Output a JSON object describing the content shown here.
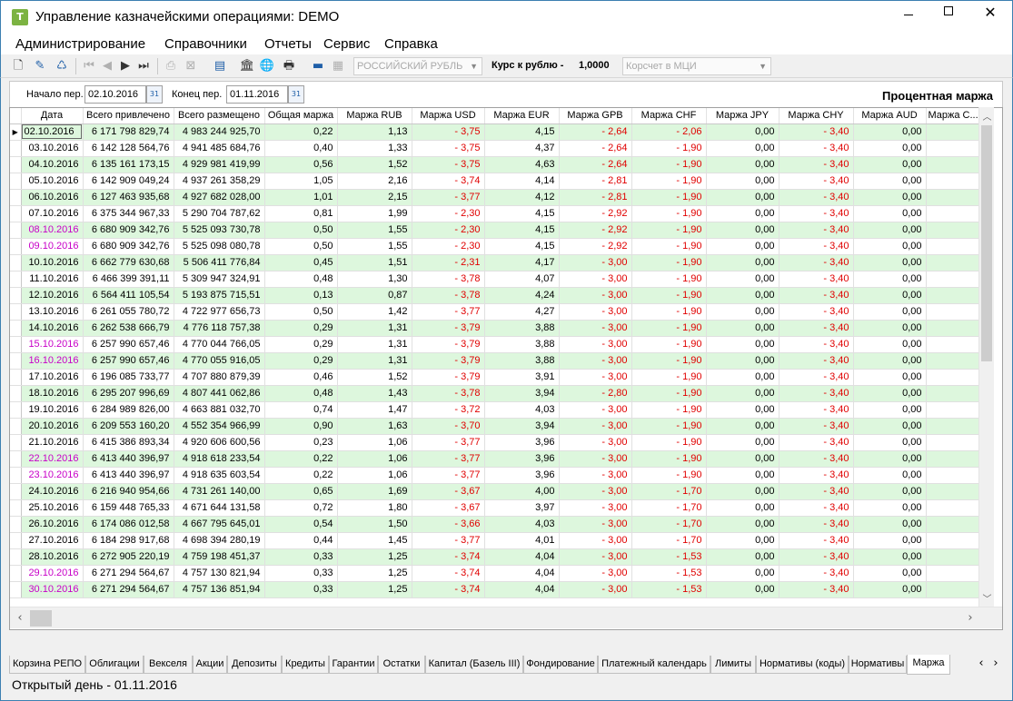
{
  "window": {
    "title": "Управление казначейскими операциями: DEMO",
    "app_icon_letter": "Т"
  },
  "menu": [
    "Администрирование",
    "Справочники",
    "Отчеты",
    "Сервис",
    "Справка"
  ],
  "toolbar": {
    "currency_value": "РОССИЙСКИЙ РУБЛЬ",
    "rate_label": "Курс к рублю -",
    "rate_value": "1,0000",
    "account_placeholder": "Корсчет в МЦИ"
  },
  "filter": {
    "start_label": "Начало пер.",
    "start_date": "02.10.2016",
    "end_label": "Конец пер.",
    "end_date": "01.11.2016",
    "report_title": "Процентная маржа"
  },
  "grid": {
    "columns": [
      "Дата",
      "Всего привлечено",
      "Всего размещено",
      "Общая маржа",
      "Маржа RUB",
      "Маржа USD",
      "Маржа EUR",
      "Маржа GPB",
      "Маржа CHF",
      "Маржа JPY",
      "Маржа CHY",
      "Маржа AUD",
      "Маржа С..."
    ],
    "rows": [
      [
        "02.10.2016",
        "6 171 798 829,74",
        "4 983 244 925,70",
        "0,22",
        "1,13",
        "- 3,75",
        "4,15",
        "- 2,64",
        "- 2,06",
        "0,00",
        "- 3,40",
        "0,00"
      ],
      [
        "03.10.2016",
        "6 142 128 564,76",
        "4 941 485 684,76",
        "0,40",
        "1,33",
        "- 3,75",
        "4,37",
        "- 2,64",
        "- 1,90",
        "0,00",
        "- 3,40",
        "0,00"
      ],
      [
        "04.10.2016",
        "6 135 161 173,15",
        "4 929 981 419,99",
        "0,56",
        "1,52",
        "- 3,75",
        "4,63",
        "- 2,64",
        "- 1,90",
        "0,00",
        "- 3,40",
        "0,00"
      ],
      [
        "05.10.2016",
        "6 142 909 049,24",
        "4 937 261 358,29",
        "1,05",
        "2,16",
        "- 3,74",
        "4,14",
        "- 2,81",
        "- 1,90",
        "0,00",
        "- 3,40",
        "0,00"
      ],
      [
        "06.10.2016",
        "6 127 463 935,68",
        "4 927 682 028,00",
        "1,01",
        "2,15",
        "- 3,77",
        "4,12",
        "- 2,81",
        "- 1,90",
        "0,00",
        "- 3,40",
        "0,00"
      ],
      [
        "07.10.2016",
        "6 375 344 967,33",
        "5 290 704 787,62",
        "0,81",
        "1,99",
        "- 2,30",
        "4,15",
        "- 2,92",
        "- 1,90",
        "0,00",
        "- 3,40",
        "0,00"
      ],
      [
        "08.10.2016",
        "6 680 909 342,76",
        "5 525 093 730,78",
        "0,50",
        "1,55",
        "- 2,30",
        "4,15",
        "- 2,92",
        "- 1,90",
        "0,00",
        "- 3,40",
        "0,00"
      ],
      [
        "09.10.2016",
        "6 680 909 342,76",
        "5 525 098 080,78",
        "0,50",
        "1,55",
        "- 2,30",
        "4,15",
        "- 2,92",
        "- 1,90",
        "0,00",
        "- 3,40",
        "0,00"
      ],
      [
        "10.10.2016",
        "6 662 779 630,68",
        "5 506 411 776,84",
        "0,45",
        "1,51",
        "- 2,31",
        "4,17",
        "- 3,00",
        "- 1,90",
        "0,00",
        "- 3,40",
        "0,00"
      ],
      [
        "11.10.2016",
        "6 466 399 391,11",
        "5 309 947 324,91",
        "0,48",
        "1,30",
        "- 3,78",
        "4,07",
        "- 3,00",
        "- 1,90",
        "0,00",
        "- 3,40",
        "0,00"
      ],
      [
        "12.10.2016",
        "6 564 411 105,54",
        "5 193 875 715,51",
        "0,13",
        "0,87",
        "- 3,78",
        "4,24",
        "- 3,00",
        "- 1,90",
        "0,00",
        "- 3,40",
        "0,00"
      ],
      [
        "13.10.2016",
        "6 261 055 780,72",
        "4 722 977 656,73",
        "0,50",
        "1,42",
        "- 3,77",
        "4,27",
        "- 3,00",
        "- 1,90",
        "0,00",
        "- 3,40",
        "0,00"
      ],
      [
        "14.10.2016",
        "6 262 538 666,79",
        "4 776 118 757,38",
        "0,29",
        "1,31",
        "- 3,79",
        "3,88",
        "- 3,00",
        "- 1,90",
        "0,00",
        "- 3,40",
        "0,00"
      ],
      [
        "15.10.2016",
        "6 257 990 657,46",
        "4 770 044 766,05",
        "0,29",
        "1,31",
        "- 3,79",
        "3,88",
        "- 3,00",
        "- 1,90",
        "0,00",
        "- 3,40",
        "0,00"
      ],
      [
        "16.10.2016",
        "6 257 990 657,46",
        "4 770 055 916,05",
        "0,29",
        "1,31",
        "- 3,79",
        "3,88",
        "- 3,00",
        "- 1,90",
        "0,00",
        "- 3,40",
        "0,00"
      ],
      [
        "17.10.2016",
        "6 196 085 733,77",
        "4 707 880 879,39",
        "0,46",
        "1,52",
        "- 3,79",
        "3,91",
        "- 3,00",
        "- 1,90",
        "0,00",
        "- 3,40",
        "0,00"
      ],
      [
        "18.10.2016",
        "6 295 207 996,69",
        "4 807 441 062,86",
        "0,48",
        "1,43",
        "- 3,78",
        "3,94",
        "- 2,80",
        "- 1,90",
        "0,00",
        "- 3,40",
        "0,00"
      ],
      [
        "19.10.2016",
        "6 284 989 826,00",
        "4 663 881 032,70",
        "0,74",
        "1,47",
        "- 3,72",
        "4,03",
        "- 3,00",
        "- 1,90",
        "0,00",
        "- 3,40",
        "0,00"
      ],
      [
        "20.10.2016",
        "6 209 553 160,20",
        "4 552 354 966,99",
        "0,90",
        "1,63",
        "- 3,70",
        "3,94",
        "- 3,00",
        "- 1,90",
        "0,00",
        "- 3,40",
        "0,00"
      ],
      [
        "21.10.2016",
        "6 415 386 893,34",
        "4 920 606 600,56",
        "0,23",
        "1,06",
        "- 3,77",
        "3,96",
        "- 3,00",
        "- 1,90",
        "0,00",
        "- 3,40",
        "0,00"
      ],
      [
        "22.10.2016",
        "6 413 440 396,97",
        "4 918 618 233,54",
        "0,22",
        "1,06",
        "- 3,77",
        "3,96",
        "- 3,00",
        "- 1,90",
        "0,00",
        "- 3,40",
        "0,00"
      ],
      [
        "23.10.2016",
        "6 413 440 396,97",
        "4 918 635 603,54",
        "0,22",
        "1,06",
        "- 3,77",
        "3,96",
        "- 3,00",
        "- 1,90",
        "0,00",
        "- 3,40",
        "0,00"
      ],
      [
        "24.10.2016",
        "6 216 940 954,66",
        "4 731 261 140,00",
        "0,65",
        "1,69",
        "- 3,67",
        "4,00",
        "- 3,00",
        "- 1,70",
        "0,00",
        "- 3,40",
        "0,00"
      ],
      [
        "25.10.2016",
        "6 159 448 765,33",
        "4 671 644 131,58",
        "0,72",
        "1,80",
        "- 3,67",
        "3,97",
        "- 3,00",
        "- 1,70",
        "0,00",
        "- 3,40",
        "0,00"
      ],
      [
        "26.10.2016",
        "6 174 086 012,58",
        "4 667 795 645,01",
        "0,54",
        "1,50",
        "- 3,66",
        "4,03",
        "- 3,00",
        "- 1,70",
        "0,00",
        "- 3,40",
        "0,00"
      ],
      [
        "27.10.2016",
        "6 184 298 917,68",
        "4 698 394 280,19",
        "0,44",
        "1,45",
        "- 3,77",
        "4,01",
        "- 3,00",
        "- 1,70",
        "0,00",
        "- 3,40",
        "0,00"
      ],
      [
        "28.10.2016",
        "6 272 905 220,19",
        "4 759 198 451,37",
        "0,33",
        "1,25",
        "- 3,74",
        "4,04",
        "- 3,00",
        "- 1,53",
        "0,00",
        "- 3,40",
        "0,00"
      ],
      [
        "29.10.2016",
        "6 271 294 564,67",
        "4 757 130 821,94",
        "0,33",
        "1,25",
        "- 3,74",
        "4,04",
        "- 3,00",
        "- 1,53",
        "0,00",
        "- 3,40",
        "0,00"
      ],
      [
        "30.10.2016",
        "6 271 294 564,67",
        "4 757 136 851,94",
        "0,33",
        "1,25",
        "- 3,74",
        "4,04",
        "- 3,00",
        "- 1,53",
        "0,00",
        "- 3,40",
        "0,00"
      ]
    ],
    "weekend_rows": [
      6,
      7,
      13,
      14,
      20,
      21,
      27,
      28
    ]
  },
  "tabs": [
    "Корзина РЕПО",
    "Облигации",
    "Векселя",
    "Акции",
    "Депозиты",
    "Кредиты",
    "Гарантии",
    "Остатки",
    "Капитал (Базель III)",
    "Фондирование",
    "Платежный календарь",
    "Лимиты",
    "Нормативы (коды)",
    "Нормативы",
    "Маржа"
  ],
  "status": {
    "text": "Открытый день - 01.11.2016"
  },
  "colors": {
    "accent": "#3c7fb1",
    "alt_row": "#ddf7dd",
    "negative": "#e00000",
    "weekend": "#c800c8"
  }
}
